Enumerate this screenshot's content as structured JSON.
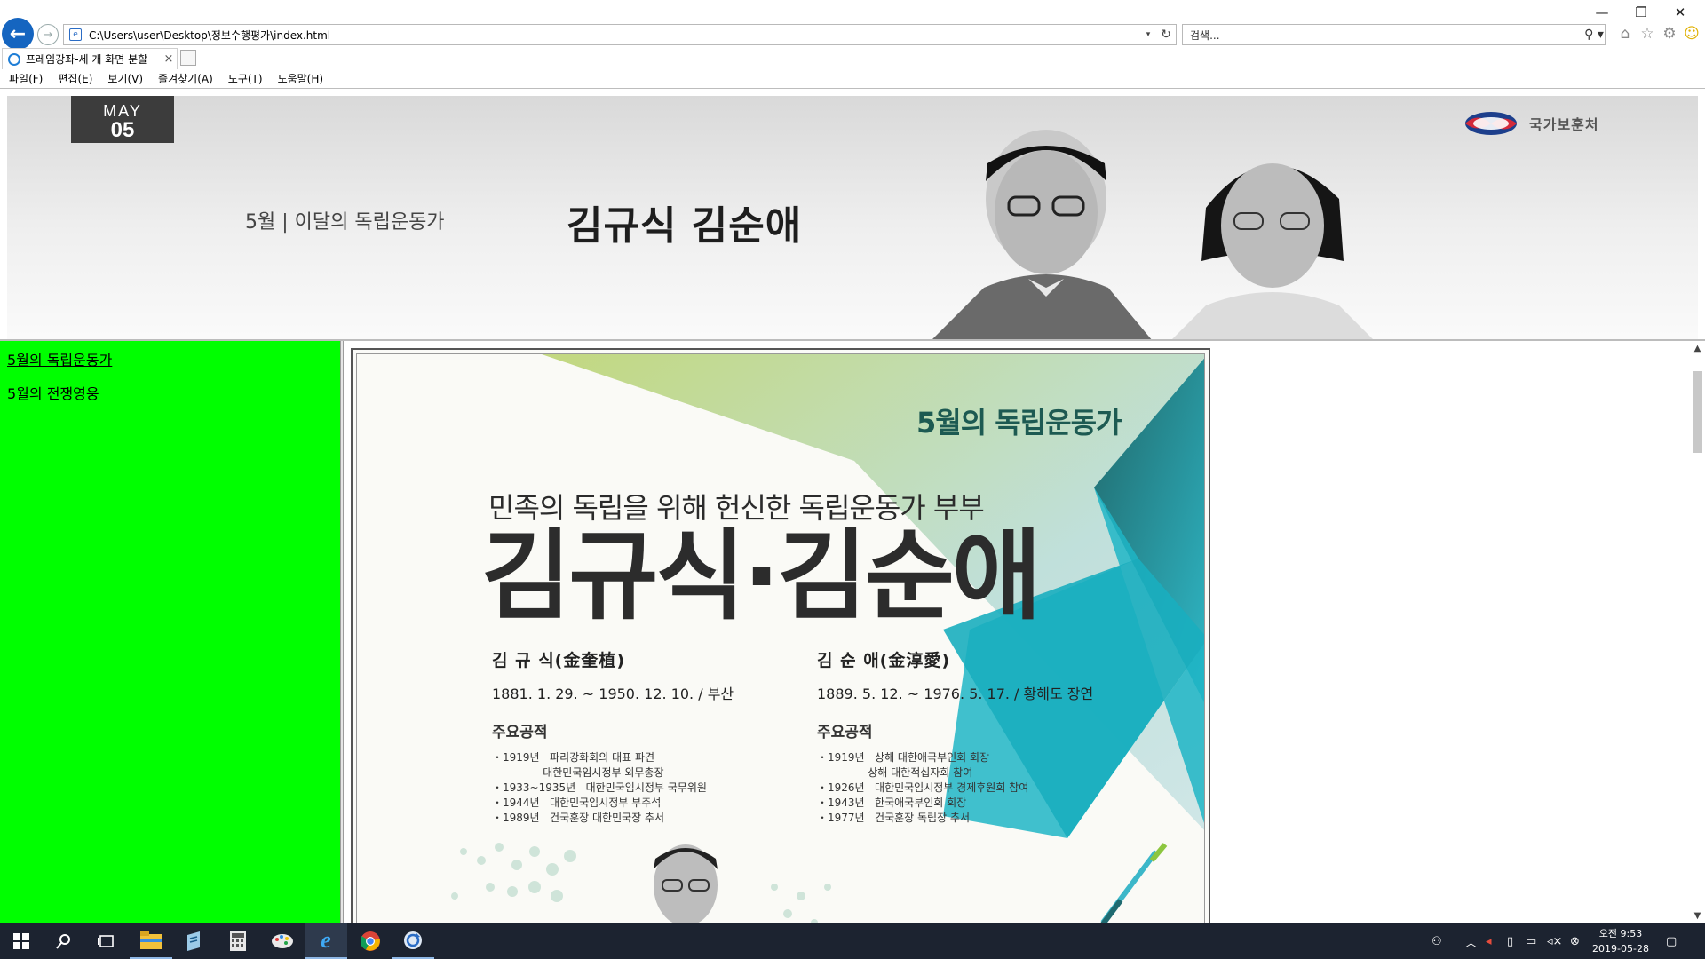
{
  "window": {
    "minimize": "—",
    "restore": "❐",
    "close": "✕"
  },
  "address_bar": {
    "url": "C:\\Users\\user\\Desktop\\정보수행평가\\index.html",
    "dropdown": "▾",
    "refresh": "↻"
  },
  "search_box": {
    "placeholder": "검색...",
    "icon": "⚲ ▾"
  },
  "tab": {
    "label": "프레임강좌-세 개 화면 분할",
    "close": "×"
  },
  "menu": [
    "파일(F)",
    "편집(E)",
    "보기(V)",
    "즐겨찾기(A)",
    "도구(T)",
    "도움말(H)"
  ],
  "banner": {
    "badge_month": "MAY",
    "badge_day": "05",
    "ministry": "국가보훈처",
    "month_line": "5월 | 이달의 독립운동가",
    "names": "김규식 김순애"
  },
  "left_nav": {
    "links": [
      "5월의 독립운동가",
      "5월의 전쟁영웅"
    ]
  },
  "poster": {
    "header": "5월의 독립운동가",
    "subtitle": "민족의 독립을 위해 헌신한 독립운동가 부부",
    "title": "김규식·김순애",
    "left": {
      "name": "김 규 식(金奎植)",
      "dates": "1881. 1. 29. ~ 1950. 12. 10. / 부산",
      "heading": "주요공적",
      "achievements": "・1919년   파리강화회의 대표 파견\n               대한민국임시정부 외무총장\n・1933~1935년   대한민국임시정부 국무위원\n・1944년   대한민국임시정부 부주석\n・1989년   건국훈장 대한민국장 추서"
    },
    "right": {
      "name": "김 순 애(金淳愛)",
      "dates": "1889. 5. 12. ~ 1976. 5. 17. / 황해도 장연",
      "heading": "주요공적",
      "achievements": "・1919년   상해 대한애국부인회 회장\n               상해 대한적십자회 참여\n・1926년   대한민국임시정부 경제후원회 참여\n・1943년   한국애국부인회 회장\n・1977년   건국훈장 독립장 추서"
    }
  },
  "scrollbar": {
    "up": "▲",
    "down": "▼"
  },
  "taskbar": {
    "clock_time": "오전 9:53",
    "clock_date": "2019-05-28"
  },
  "colors": {
    "left_frame_bg": "#00ff00",
    "taskbar_bg": "#1c2330",
    "poster_green": "#1d5a52",
    "poster_teal": "#1eb5c6"
  }
}
